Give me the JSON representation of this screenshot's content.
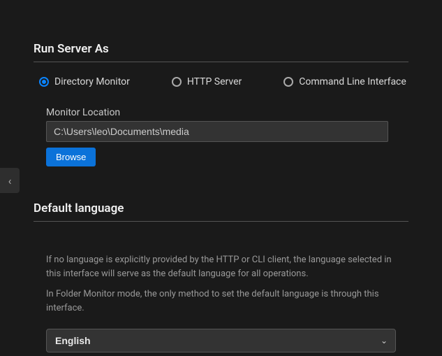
{
  "runServer": {
    "title": "Run Server As",
    "options": [
      {
        "label": "Directory Monitor",
        "selected": true
      },
      {
        "label": "HTTP Server",
        "selected": false
      },
      {
        "label": "Command Line Interface",
        "selected": false
      }
    ],
    "monitorLocation": {
      "label": "Monitor Location",
      "value": "C:\\Users\\leo\\Documents\\media",
      "browseLabel": "Browse"
    }
  },
  "defaultLanguage": {
    "title": "Default language",
    "help1": "If no language is explicitly provided by the HTTP or CLI client, the language selected in this interface will serve as the default language for all operations.",
    "help2": "In Folder Monitor mode, the only method to set the default language is through this interface.",
    "selected": "English"
  },
  "sideTab": {
    "glyph": "‹"
  }
}
